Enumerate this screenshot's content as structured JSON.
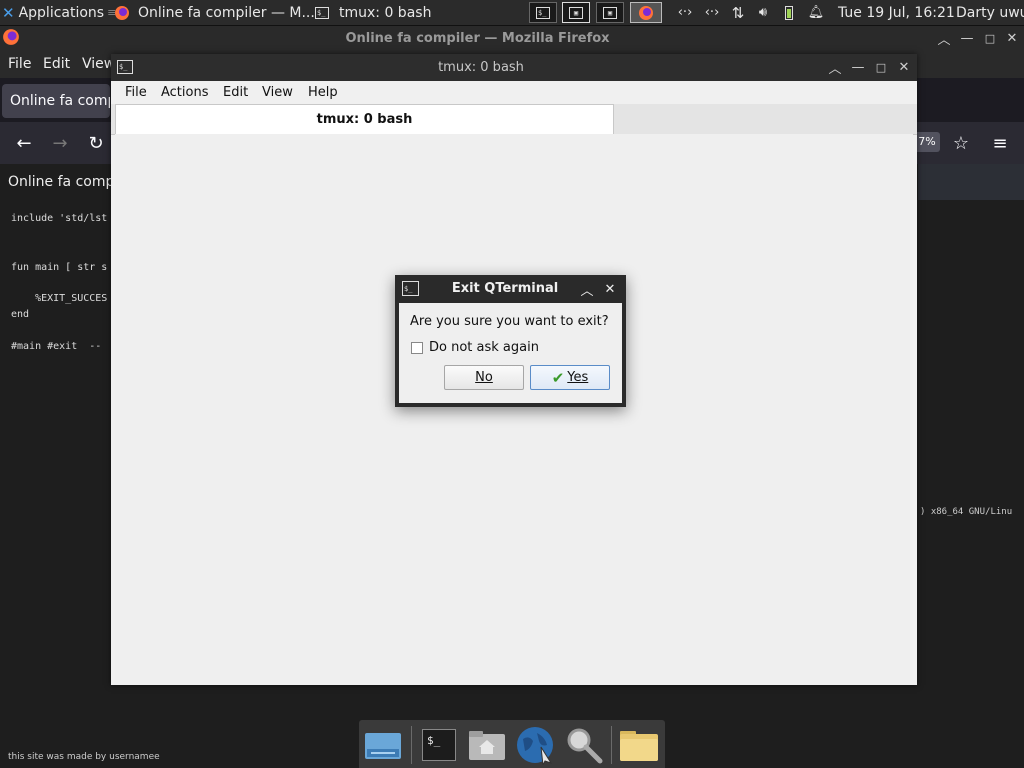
{
  "top_panel": {
    "applications_label": "Applications",
    "tasks": [
      {
        "label": "Online fa compiler — M..."
      },
      {
        "label": "tmux: 0 bash"
      }
    ],
    "clock": "Tue 19 Jul, 16:21",
    "user": "Darty uwu"
  },
  "firefox": {
    "window_title": "Online fa compiler — Mozilla Firefox",
    "menu": [
      "File",
      "Edit",
      "View"
    ],
    "tab_label": "Online fa compiler",
    "zoom_label": "7%",
    "page_title": "Online fa comp",
    "code_lines": [
      "include 'std/lst",
      "fun main [ str s",
      "    %EXIT_SUCCES",
      "end",
      "#main #exit  --"
    ],
    "right_code": ") x86_64 GNU/Linu",
    "footer": "this site was made by usernamee"
  },
  "qterminal": {
    "window_title": "tmux: 0 bash",
    "menu": [
      "File",
      "Actions",
      "Edit",
      "View",
      "Help"
    ],
    "tab_label": "tmux: 0 bash"
  },
  "dialog": {
    "title": "Exit QTerminal",
    "message": "Are you sure you want to exit?",
    "checkbox_label": "Do not ask again",
    "checkbox_checked": false,
    "no_label": "No",
    "yes_label": "Yes"
  },
  "dock": {
    "items": [
      "files-icon",
      "terminal-icon",
      "home-folder-icon",
      "web-browser-icon",
      "search-icon",
      "folder-icon"
    ]
  },
  "colors": {
    "panel_bg": "#2b2b2b",
    "window_bg": "#f0f0f0",
    "dialog_default_border": "#5a8cc8"
  }
}
